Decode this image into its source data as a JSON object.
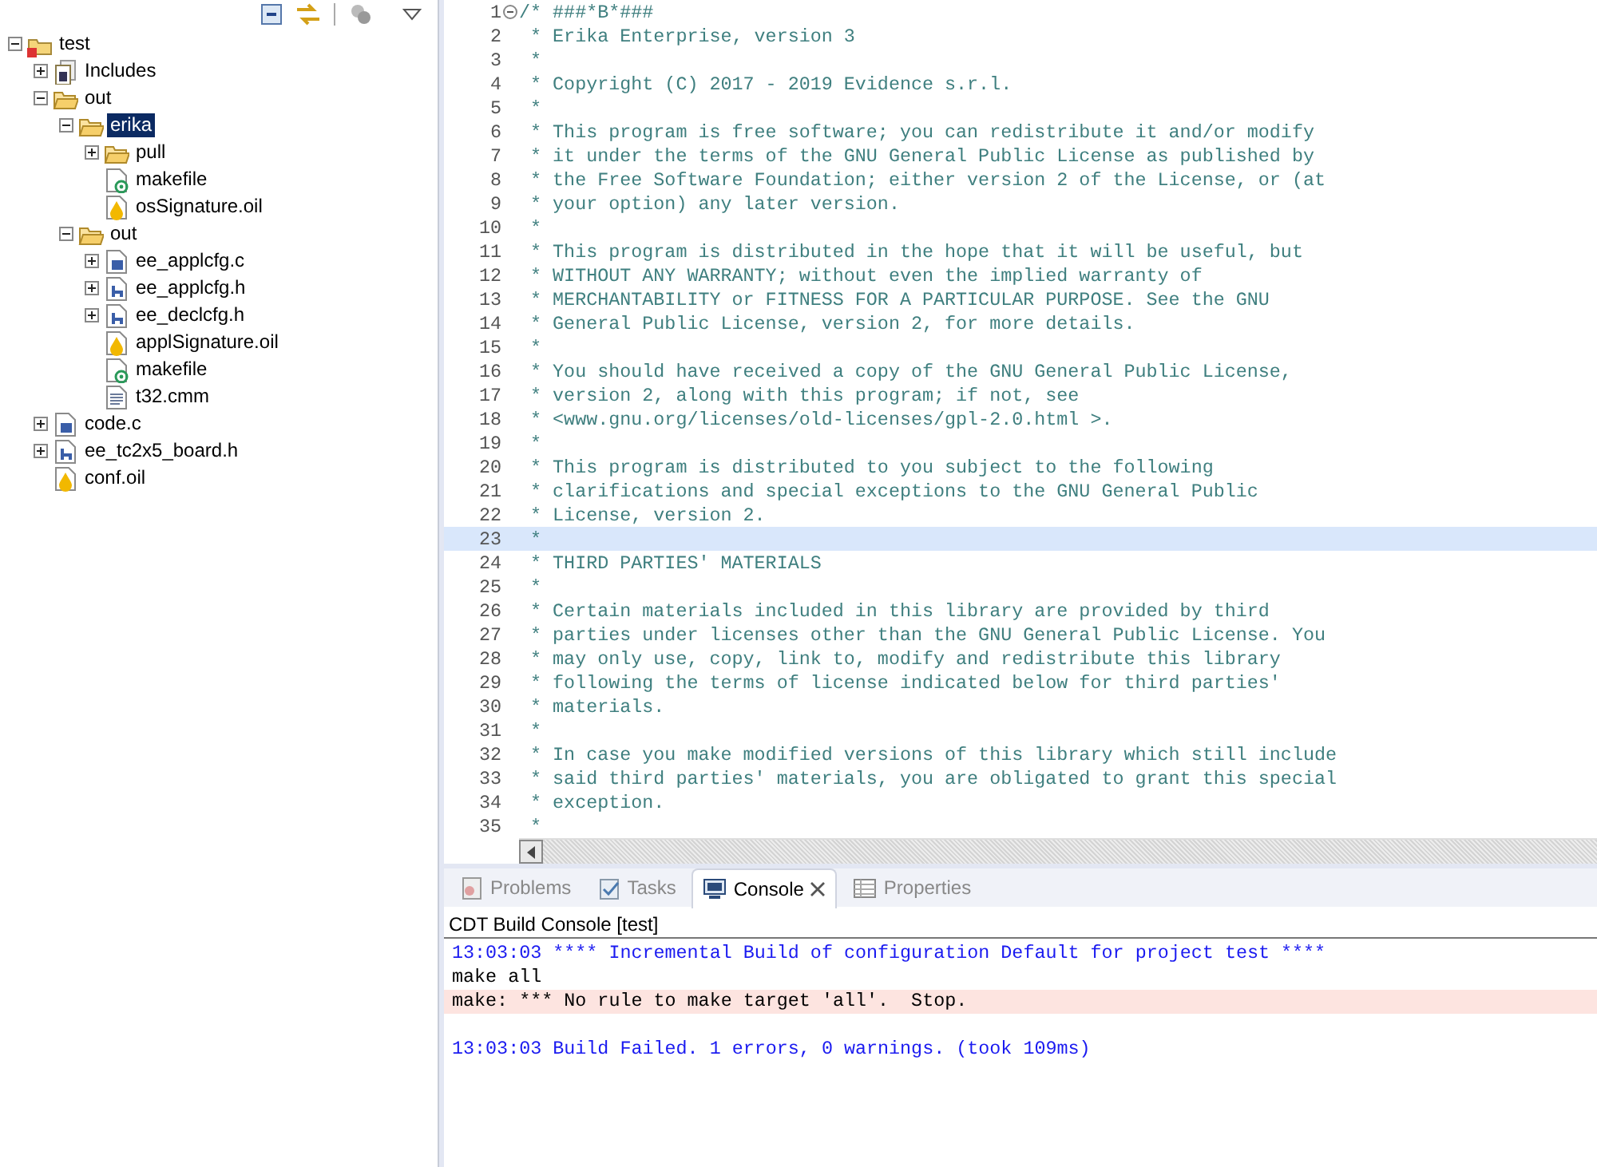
{
  "explorer": {
    "tree": [
      {
        "label": "test",
        "kind": "project",
        "expanded": true,
        "selected": false,
        "children": [
          {
            "label": "Includes",
            "kind": "includes",
            "expanded": false,
            "selected": false
          },
          {
            "label": "out",
            "kind": "folder",
            "expanded": true,
            "selected": false,
            "children": [
              {
                "label": "erika",
                "kind": "folder",
                "expanded": true,
                "selected": true,
                "children": [
                  {
                    "label": "pull",
                    "kind": "folder",
                    "expanded": false,
                    "selected": false
                  },
                  {
                    "label": "makefile",
                    "kind": "makefile",
                    "selected": false
                  },
                  {
                    "label": "osSignature.oil",
                    "kind": "oil",
                    "selected": false
                  }
                ]
              },
              {
                "label": "out",
                "kind": "folder",
                "expanded": true,
                "selected": false,
                "children": [
                  {
                    "label": "ee_applcfg.c",
                    "kind": "c-file",
                    "expanded": false,
                    "selected": false
                  },
                  {
                    "label": "ee_applcfg.h",
                    "kind": "h-file",
                    "expanded": false,
                    "selected": false
                  },
                  {
                    "label": "ee_declcfg.h",
                    "kind": "h-file",
                    "expanded": false,
                    "selected": false
                  },
                  {
                    "label": "applSignature.oil",
                    "kind": "oil",
                    "selected": false
                  },
                  {
                    "label": "makefile",
                    "kind": "makefile",
                    "selected": false
                  },
                  {
                    "label": "t32.cmm",
                    "kind": "text",
                    "selected": false
                  }
                ]
              }
            ]
          },
          {
            "label": "code.c",
            "kind": "c-file",
            "expanded": false,
            "selected": false
          },
          {
            "label": "ee_tc2x5_board.h",
            "kind": "h-file",
            "expanded": false,
            "selected": false
          },
          {
            "label": "conf.oil",
            "kind": "oil",
            "selected": false
          }
        ]
      }
    ]
  },
  "editor": {
    "lines": [
      {
        "number": "1",
        "text": "/* ###*B*###",
        "current": false
      },
      {
        "number": "2",
        "text": " * Erika Enterprise, version 3",
        "current": false
      },
      {
        "number": "3",
        "text": " *",
        "current": false
      },
      {
        "number": "4",
        "text": " * Copyright (C) 2017 - 2019 Evidence s.r.l.",
        "current": false
      },
      {
        "number": "5",
        "text": " *",
        "current": false
      },
      {
        "number": "6",
        "text": " * This program is free software; you can redistribute it and/or modify",
        "current": false
      },
      {
        "number": "7",
        "text": " * it under the terms of the GNU General Public License as published by",
        "current": false
      },
      {
        "number": "8",
        "text": " * the Free Software Foundation; either version 2 of the License, or (at",
        "current": false
      },
      {
        "number": "9",
        "text": " * your option) any later version.",
        "current": false
      },
      {
        "number": "10",
        "text": " *",
        "current": false
      },
      {
        "number": "11",
        "text": " * This program is distributed in the hope that it will be useful, but",
        "current": false
      },
      {
        "number": "12",
        "text": " * WITHOUT ANY WARRANTY; without even the implied warranty of",
        "current": false
      },
      {
        "number": "13",
        "text": " * MERCHANTABILITY or FITNESS FOR A PARTICULAR PURPOSE. See the GNU",
        "current": false
      },
      {
        "number": "14",
        "text": " * General Public License, version 2, for more details.",
        "current": false
      },
      {
        "number": "15",
        "text": " *",
        "current": false
      },
      {
        "number": "16",
        "text": " * You should have received a copy of the GNU General Public License,",
        "current": false
      },
      {
        "number": "17",
        "text": " * version 2, along with this program; if not, see",
        "current": false
      },
      {
        "number": "18",
        "text": " * <www.gnu.org/licenses/old-licenses/gpl-2.0.html >.",
        "current": false
      },
      {
        "number": "19",
        "text": " *",
        "current": false
      },
      {
        "number": "20",
        "text": " * This program is distributed to you subject to the following",
        "current": false
      },
      {
        "number": "21",
        "text": " * clarifications and special exceptions to the GNU General Public",
        "current": false
      },
      {
        "number": "22",
        "text": " * License, version 2.",
        "current": false
      },
      {
        "number": "23",
        "text": " *",
        "current": true
      },
      {
        "number": "24",
        "text": " * THIRD PARTIES' MATERIALS",
        "current": false
      },
      {
        "number": "25",
        "text": " *",
        "current": false
      },
      {
        "number": "26",
        "text": " * Certain materials included in this library are provided by third",
        "current": false
      },
      {
        "number": "27",
        "text": " * parties under licenses other than the GNU General Public License. You",
        "current": false
      },
      {
        "number": "28",
        "text": " * may only use, copy, link to, modify and redistribute this library",
        "current": false
      },
      {
        "number": "29",
        "text": " * following the terms of license indicated below for third parties'",
        "current": false
      },
      {
        "number": "30",
        "text": " * materials.",
        "current": false
      },
      {
        "number": "31",
        "text": " *",
        "current": false
      },
      {
        "number": "32",
        "text": " * In case you make modified versions of this library which still include",
        "current": false
      },
      {
        "number": "33",
        "text": " * said third parties' materials, you are obligated to grant this special",
        "current": false
      },
      {
        "number": "34",
        "text": " * exception.",
        "current": false
      },
      {
        "number": "35",
        "text": " *",
        "current": false
      }
    ]
  },
  "panel": {
    "tabs": [
      {
        "label": "Problems",
        "kind": "problems",
        "selected": false
      },
      {
        "label": "Tasks",
        "kind": "tasks",
        "selected": false
      },
      {
        "label": "Console",
        "kind": "console",
        "selected": true
      },
      {
        "label": "Properties",
        "kind": "properties",
        "selected": false
      }
    ],
    "console": {
      "title": "CDT Build Console [test]",
      "lines": [
        {
          "kind": "info",
          "text": "13:03:03 **** Incremental Build of configuration Default for project test ****"
        },
        {
          "kind": "output",
          "text": "make all"
        },
        {
          "kind": "error",
          "text": "make: *** No rule to make target 'all'.  Stop."
        },
        {
          "kind": "blank"
        },
        {
          "kind": "info",
          "text": "13:03:03 Build Failed. 1 errors, 0 warnings. (took 109ms)"
        }
      ]
    }
  }
}
